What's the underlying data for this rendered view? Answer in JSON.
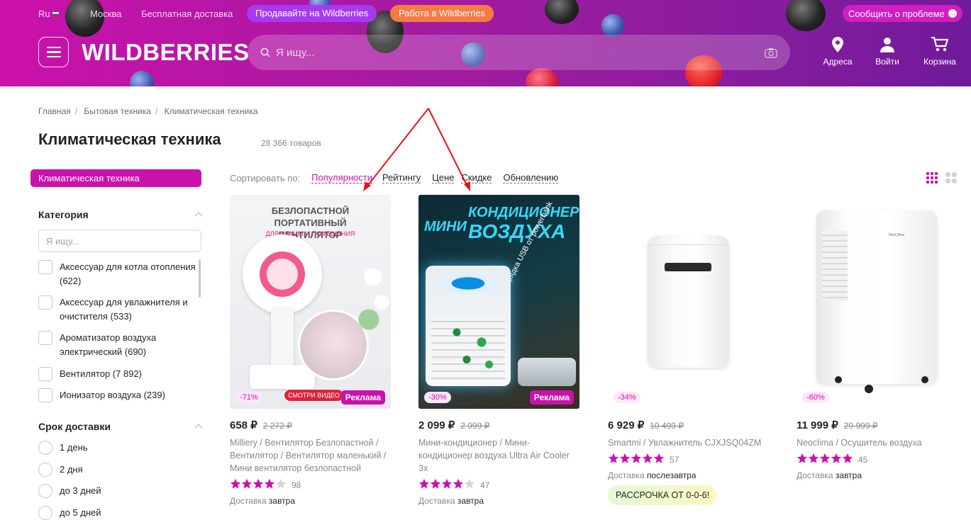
{
  "topbar": {
    "lang": "Ru",
    "city": "Москва",
    "free_delivery": "Бесплатная доставка",
    "sell": "Продавайте на Wildberries",
    "work": "Работа в Wildberries",
    "report": "Сообщить о проблеме"
  },
  "header": {
    "logo": "WILDBERRIES",
    "search_placeholder": "Я ищу...",
    "address": "Адреса",
    "login": "Войти",
    "cart": "Корзина"
  },
  "breadcrumbs": [
    "Главная",
    "Бытовая техника",
    "Климатическая техника"
  ],
  "page": {
    "title": "Климатическая техника",
    "count": "28 366 товаров"
  },
  "sidebar": {
    "active_category": "Климатическая техника",
    "category_heading": "Категория",
    "search_placeholder": "Я ищу...",
    "categories": [
      "Аксессуар для котла отопления (622)",
      "Аксессуар для увлажнителя и очистителя (533)",
      "Ароматизатор воздуха электрический (690)",
      "Вентилятор (7 892)",
      "Ионизатор воздуха (239)"
    ],
    "delivery_heading": "Срок доставки",
    "delivery_options": [
      "1 день",
      "2 дня",
      "до 3 дней",
      "до 5 дней"
    ]
  },
  "sort": {
    "label": "Сортировать по:",
    "options": [
      "Популярности",
      "Рейтингу",
      "Цене",
      "Скидке",
      "Обновлению"
    ],
    "active": "Популярности"
  },
  "products": [
    {
      "price": "658 ₽",
      "old_price": "2 272 ₽",
      "discount": "-71%",
      "ad": "Реклама",
      "video": "СМОТРИ ВИДЕО",
      "image_title": "БЕЗЛОПАСТНОЙ ПОРТАТИВНЫЙ ВЕНТИЛЯТОР",
      "image_subtitle": "ДЛЯ УЛИЦЫ И ПОМЕЩЕНИЯ",
      "name": "Milliery / Вентилятор Безлопастной / Вентилятор / Вентилятор маленький / Мини вентилятор безлопастной",
      "rating": 4,
      "reviews": "98",
      "delivery_label": "Доставка",
      "delivery_value": "завтра"
    },
    {
      "price": "2 099 ₽",
      "old_price": "2 999 ₽",
      "discount": "-30%",
      "ad": "Реклама",
      "image_title_1": "МИНИ",
      "image_title_2": "КОНДИЦИОНЕР",
      "image_title_3": "ВОЗДУХА",
      "image_side": "Зарядка USB от powerbank",
      "name": "Мини-кондиционер / Мини-кондиционер воздуха Ultra Air Cooler 3x",
      "rating": 4,
      "reviews": "47",
      "delivery_label": "Доставка",
      "delivery_value": "завтра"
    },
    {
      "price": "6 929 ₽",
      "old_price": "10 499 ₽",
      "discount": "-34%",
      "name": "Smartmi / Увлажнитель CJXJSQ04ZM",
      "rating": 5,
      "reviews": "57",
      "delivery_label": "Доставка",
      "delivery_value": "послезавтра",
      "installment": "РАССРОЧКА ОТ 0-0-6!"
    },
    {
      "price": "11 999 ₽",
      "old_price": "29 999 ₽",
      "discount": "-60%",
      "name": "Neoclima / Осушитель воздуха",
      "rating": 5,
      "reviews": "45",
      "delivery_label": "Доставка",
      "delivery_value": "завтра",
      "device_label": "NeoClima"
    }
  ],
  "colors": {
    "brand": "#cb11ab",
    "annotation_arrow": "#e8141a",
    "star": "#cb11ab"
  }
}
